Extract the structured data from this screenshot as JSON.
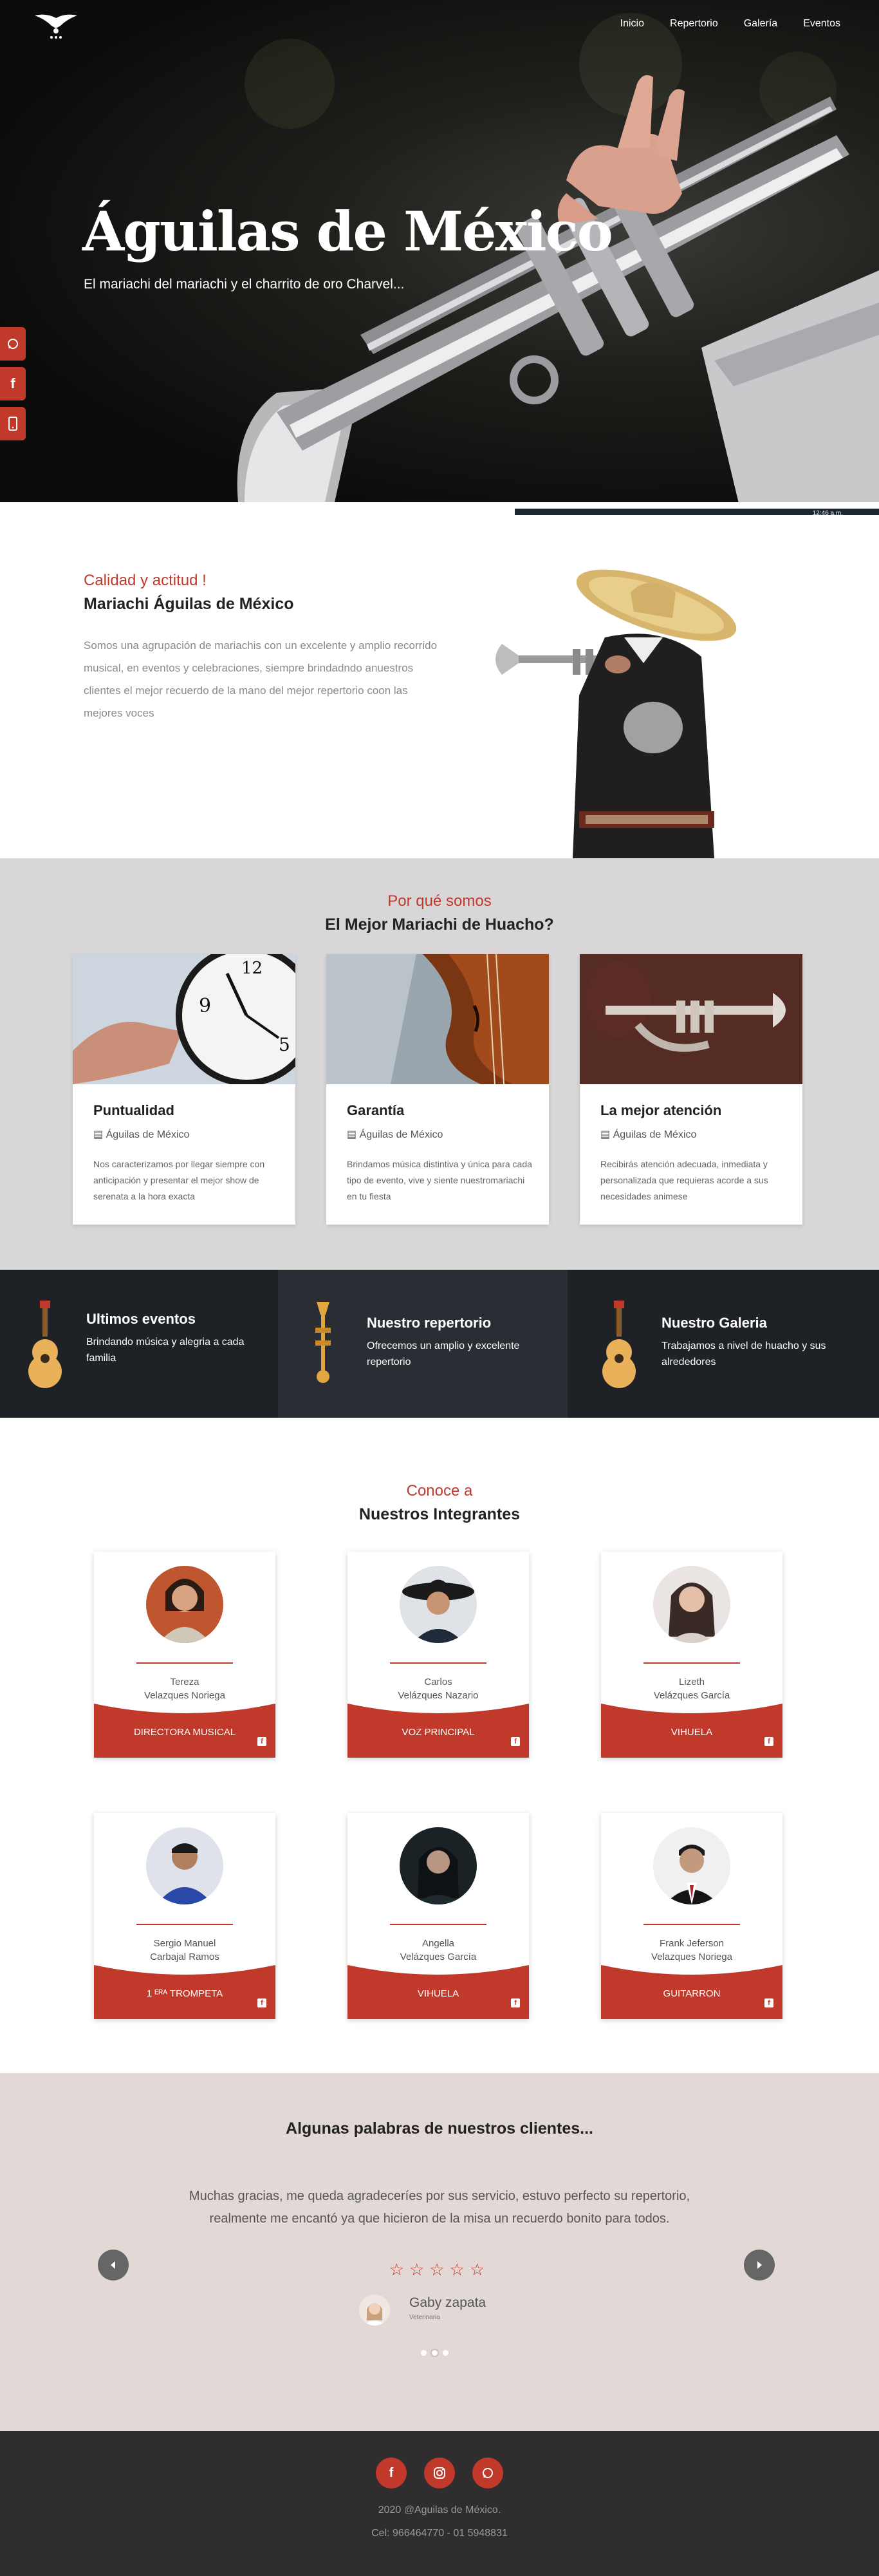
{
  "nav": {
    "items": [
      "Inicio",
      "Repertorio",
      "Galería",
      "Eventos"
    ]
  },
  "hero": {
    "title": "Águilas de México",
    "subtitle": "El mariachi del mariachi y el charrito de oro Charvel...",
    "time": "12:46 a.m."
  },
  "about": {
    "accent": "Calidad y actitud !",
    "title": "Mariachi Águilas de México",
    "text": "Somos una agrupación de mariachis con un excelente y amplio recorrido musical, en eventos y celebraciones, siempre brindadndo anuestros clientes el mejor recuerdo de la mano del mejor repertorio coon las mejores voces"
  },
  "why": {
    "accent": "Por qué somos",
    "title": "El Mejor Mariachi de Huacho?",
    "cards": [
      {
        "title": "Puntualidad",
        "meta": "Águilas de México",
        "text": "Nos caracterizamos por llegar siempre con anticipación y presentar el mejor show de serenata a la hora exacta"
      },
      {
        "title": "Garantía",
        "meta": "Águilas de México",
        "text": "Brindamos música distintiva y única para cada tipo de evento, vive y siente nuestromariachi en tu fiesta"
      },
      {
        "title": "La mejor atención",
        "meta": "Águilas de México",
        "text": "Recibirás atención adecuada, inmediata y personalizada que requieras acorde a sus necesidades animese"
      }
    ]
  },
  "band": {
    "items": [
      {
        "title": "Ultimos eventos",
        "text": "Brindando música y alegria a cada familia"
      },
      {
        "title": "Nuestro repertorio",
        "text": "Ofrecemos un amplio y excelente repertorio"
      },
      {
        "title": "Nuestro Galeria",
        "text": "Trabajamos a nivel de huacho y sus alrededores"
      }
    ]
  },
  "team": {
    "accent": "Conoce a",
    "title": "Nuestros Integrantes",
    "members": [
      {
        "name1": "Tereza",
        "name2": "Velazques Noriega",
        "role": "DIRECTORA MUSICAL"
      },
      {
        "name1": "Carlos",
        "name2": "Velázques Nazario",
        "role": "VOZ PRINCIPAL"
      },
      {
        "name1": "Lizeth",
        "name2": "Velázques García",
        "role": "VIHUELA"
      },
      {
        "name1": "Sergio Manuel",
        "name2": "Carbajal Ramos",
        "role": "1 ᴱᴿᴬ TROMPETA"
      },
      {
        "name1": "Angella",
        "name2": "Velázques García",
        "role": "VIHUELA"
      },
      {
        "name1": "Frank Jeferson",
        "name2": "Velazques Noriega",
        "role": "GUITARRON"
      }
    ]
  },
  "testimonials": {
    "title": "Algunas palabras de nuestros clientes...",
    "quote": "Muchas gracias, me queda agradeceríes por sus servicio, estuvo perfecto su repertorio, realmente me encantó ya que hicieron de la misa un recuerdo bonito para todos.",
    "stars": "☆☆☆☆☆",
    "client_name": "Gaby zapata",
    "client_role": "Veterinaria"
  },
  "footer": {
    "copyright": "2020 @Aguilas de México.",
    "phone": "Cel: 966464770 - 01 5948831"
  },
  "colors": {
    "accent": "#c0392b",
    "dark_band": "#1e2125",
    "footer": "#2f2d2d"
  }
}
